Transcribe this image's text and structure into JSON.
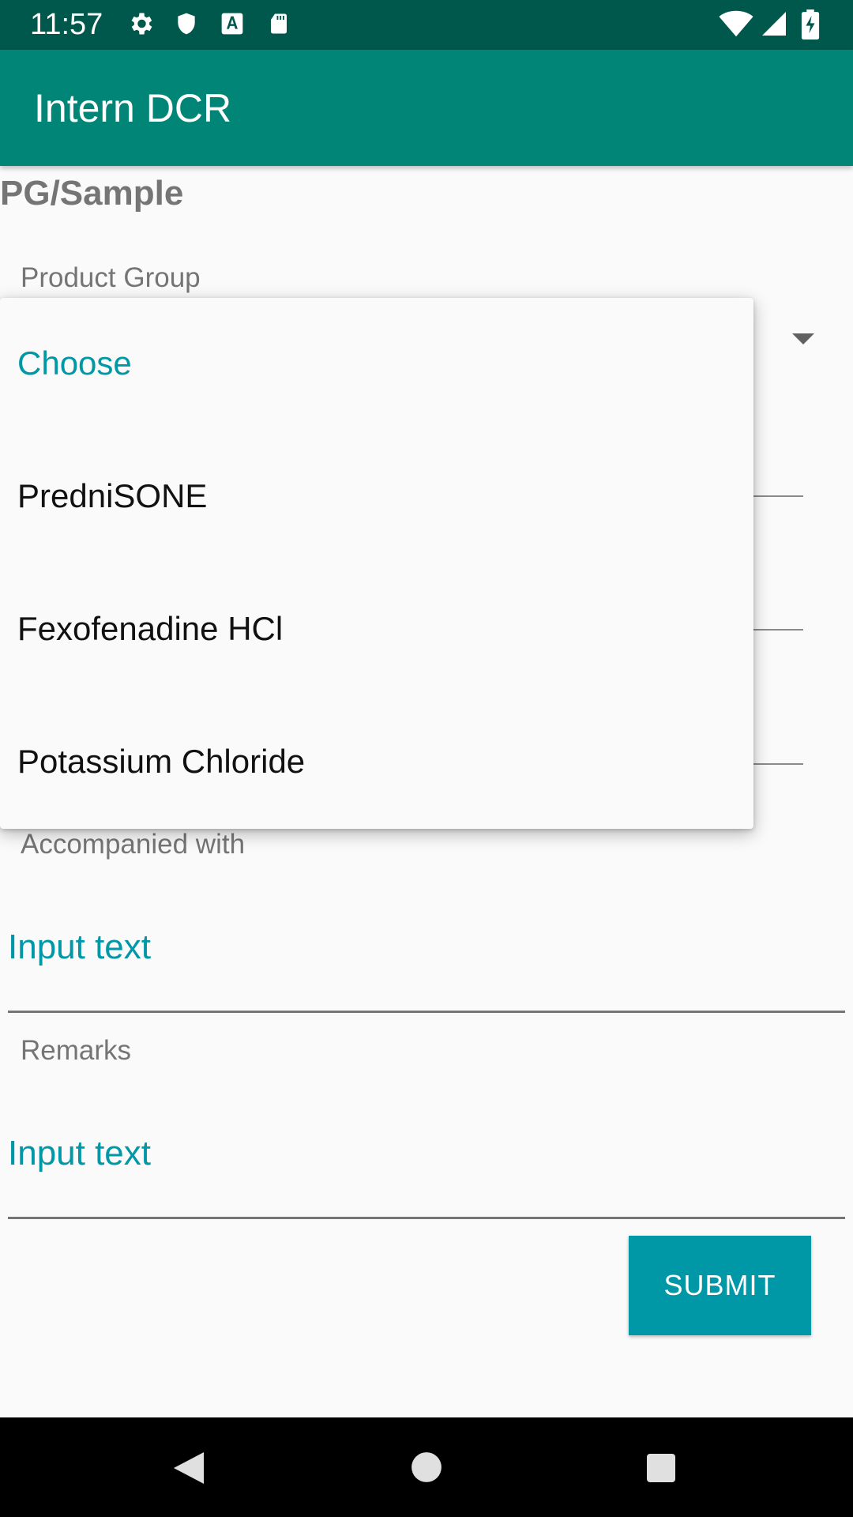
{
  "status_bar": {
    "time": "11:57",
    "left_icons": [
      "gear-icon",
      "shield-icon",
      "font-a-icon",
      "sd-card-icon"
    ],
    "right_icons": [
      "wifi-icon",
      "signal-icon",
      "battery-charging-icon"
    ]
  },
  "app_bar": {
    "title": "Intern DCR"
  },
  "form": {
    "section_title": "PG/Sample",
    "product_group_label": "Product Group",
    "accompanied_label": "Accompanied with",
    "accompanied_placeholder": "Input text",
    "remarks_label": "Remarks",
    "remarks_placeholder": "Input text",
    "submit_label": "SUBMIT"
  },
  "dropdown": {
    "selected": "Choose",
    "options": [
      "Choose",
      "PredniSONE",
      "Fexofenadine HCl",
      "Potassium Chloride"
    ]
  },
  "colors": {
    "status_bar": "#00574b",
    "app_bar": "#008577",
    "accent": "#0097a7"
  },
  "nav_bar": {
    "icons": [
      "back-icon",
      "home-icon",
      "recents-icon"
    ]
  }
}
